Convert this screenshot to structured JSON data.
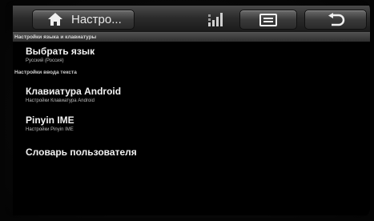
{
  "action_bar": {
    "title": "Настро...",
    "icons": {
      "home": "home-icon",
      "signal": "signal-bars-icon",
      "menu": "menu-icon",
      "back": "back-arrow-icon"
    }
  },
  "sections": [
    {
      "header": "Настройки языка и клавиатуры",
      "items": [
        {
          "title": "Выбрать язык",
          "summary": "Русский (Россия)"
        }
      ]
    },
    {
      "header": "Настройки ввода текста",
      "items": [
        {
          "title": "Клавиатура Android",
          "summary": "Настройки Клавиатура Android"
        },
        {
          "title": "Pinyin IME",
          "summary": "Настройки Pinyin IME"
        },
        {
          "title": "Словарь пользователя",
          "summary": ""
        }
      ]
    }
  ],
  "colors": {
    "background": "#000000",
    "text_primary": "#f2f2f2",
    "text_secondary": "#bcbcbc",
    "action_bar": "#2c2c2c"
  }
}
